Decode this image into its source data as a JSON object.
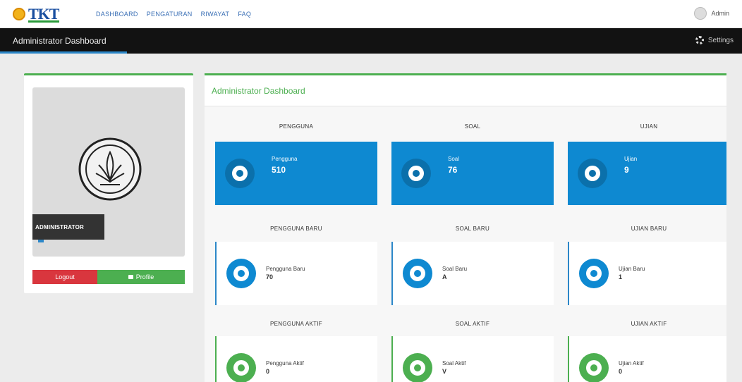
{
  "topnav": {
    "logo_text": "TKT",
    "links": [
      "DASHBOARD",
      "PENGATURAN",
      "RIWAYAT",
      "FAQ"
    ],
    "user_name": "Admin"
  },
  "titlebar": {
    "title": "Administrator Dashboard",
    "right_label": "Settings"
  },
  "profile": {
    "role": "ADMINISTRATOR",
    "btn_left": "Logout",
    "btn_right": "Profile"
  },
  "main": {
    "header": "Administrator Dashboard",
    "columns": [
      {
        "title_1": "PENGGUNA",
        "blue": {
          "label": "Pengguna",
          "value": "510"
        },
        "title_2": "PENGGUNA BARU",
        "mid": {
          "label": "Pengguna Baru",
          "value": "70"
        },
        "title_3": "PENGGUNA AKTIF",
        "bottom": {
          "label": "Pengguna Aktif",
          "value": "0"
        }
      },
      {
        "title_1": "SOAL",
        "blue": {
          "label": "Soal",
          "value": "76"
        },
        "title_2": "SOAL BARU",
        "mid": {
          "label": "Soal Baru",
          "value": "A"
        },
        "title_3": "SOAL AKTIF",
        "bottom": {
          "label": "Soal Aktif",
          "value": "V"
        }
      },
      {
        "title_1": "UJIAN",
        "blue": {
          "label": "Ujian",
          "value": "9"
        },
        "title_2": "UJIAN BARU",
        "mid": {
          "label": "Ujian Baru",
          "value": "1"
        },
        "title_3": "UJIAN AKTIF",
        "bottom": {
          "label": "Ujian Aktif",
          "value": "0"
        }
      }
    ]
  },
  "colors": {
    "blue": "#0e89d1",
    "green": "#4caf50",
    "red": "#d9363e",
    "dark": "#121212"
  }
}
